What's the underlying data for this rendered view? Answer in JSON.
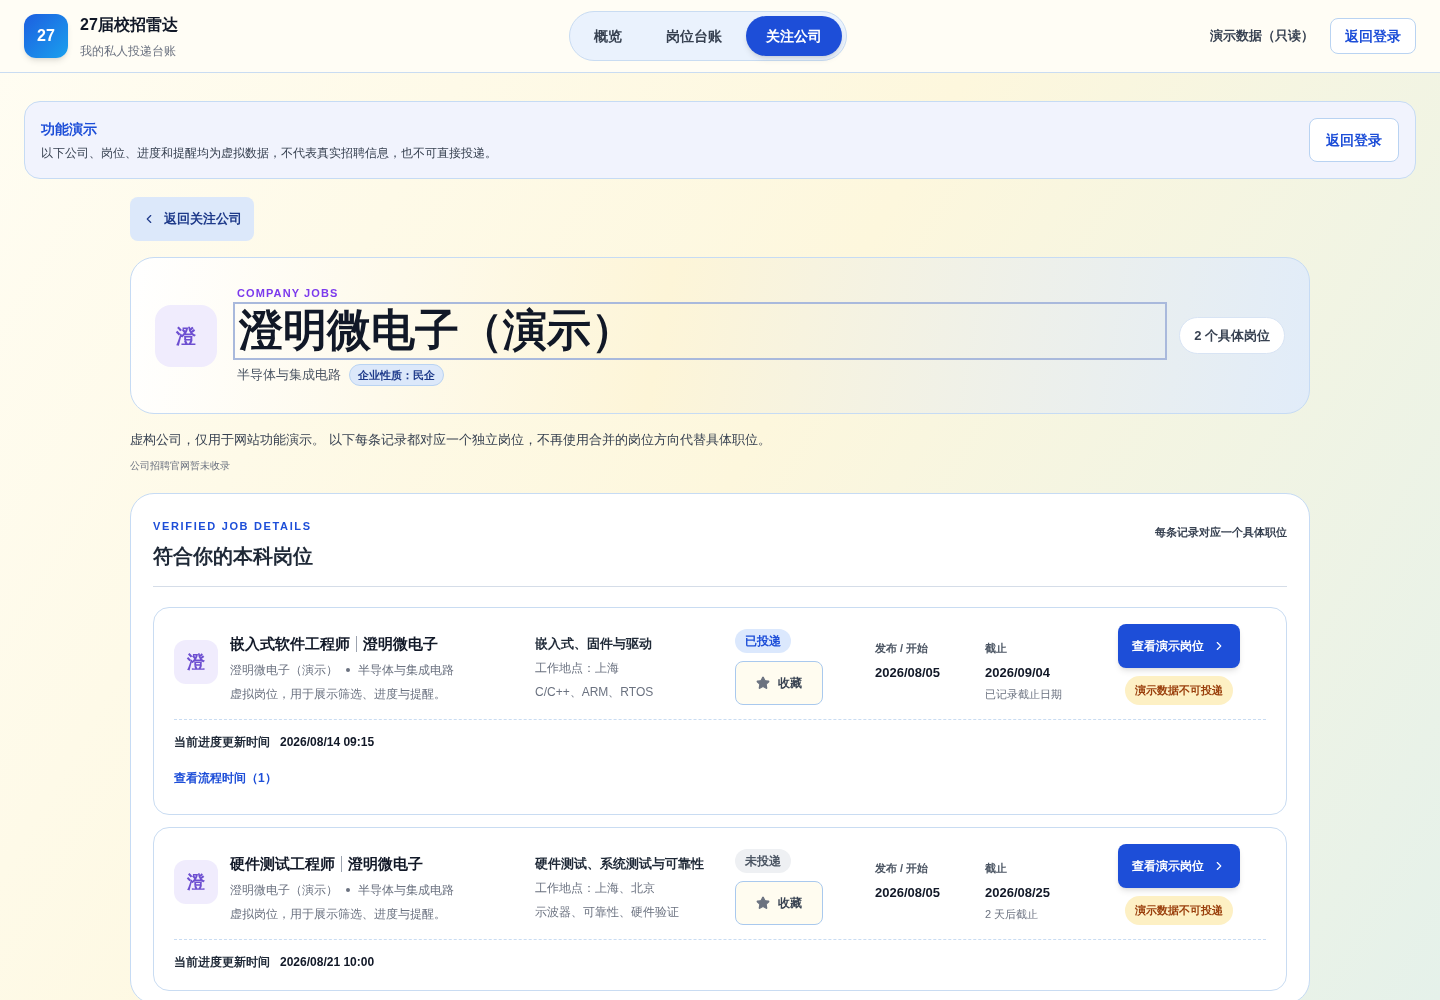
{
  "app": {
    "logo": "27",
    "title": "27届校招雷达",
    "subtitle": "我的私人投递台账"
  },
  "tabs": [
    {
      "label": "概览",
      "selected": false
    },
    {
      "label": "岗位台账",
      "selected": false
    },
    {
      "label": "关注公司",
      "selected": true
    }
  ],
  "header_right": {
    "mode": "演示数据（只读）",
    "login": "返回登录"
  },
  "notice": {
    "title": "功能演示",
    "text": "以下公司、岗位、进度和提醒均为虚拟数据，不代表真实招聘信息，也不可直接投递。",
    "button": "返回登录"
  },
  "back_button": "返回关注公司",
  "company": {
    "avatar": "澄",
    "eyebrow": "COMPANY JOBS",
    "name": "澄明微电子（演示）",
    "name_focused": true,
    "industry": "半导体与集成电路",
    "tag": "企业性质：民企",
    "count": "2 个具体岗位"
  },
  "description": "虚构公司，仅用于网站功能演示。 以下每条记录都对应一个独立岗位，不再使用合并的岗位方向代替具体职位。",
  "site_note": "公司招聘官网暂未收录",
  "jobs_section": {
    "eyebrow": "VERIFIED JOB DETAILS",
    "title": "符合你的本科岗位",
    "note": "每条记录对应一个具体职位"
  },
  "jobs": [
    {
      "avatar": "澄",
      "title": "嵌入式软件工程师",
      "company": "澄明微电子",
      "company_full": "澄明微电子（演示）",
      "industry": "半导体与集成电路",
      "desc": "虚拟岗位，用于展示筛选、进度与提醒。",
      "direction": "嵌入式、固件与驱动",
      "location": "工作地点：上海",
      "skills": "C/C++、ARM、RTOS",
      "status": "已投递",
      "applied": true,
      "favorite": "收藏",
      "start_label": "发布 / 开始",
      "start": "2026/08/05",
      "deadline_label": "截止",
      "deadline": "2026/09/04",
      "deadline_note": "已记录截止日期",
      "view": "查看演示岗位",
      "warn": "演示数据不可投递",
      "progress_label": "当前进度更新时间",
      "progress_time": "2026/08/14 09:15",
      "timeline_link": "查看流程时间（1）"
    },
    {
      "avatar": "澄",
      "title": "硬件测试工程师",
      "company": "澄明微电子",
      "company_full": "澄明微电子（演示）",
      "industry": "半导体与集成电路",
      "desc": "虚拟岗位，用于展示筛选、进度与提醒。",
      "direction": "硬件测试、系统测试与可靠性",
      "location": "工作地点：上海、北京",
      "skills": "示波器、可靠性、硬件验证",
      "status": "未投递",
      "applied": false,
      "favorite": "收藏",
      "start_label": "发布 / 开始",
      "start": "2026/08/05",
      "deadline_label": "截止",
      "deadline": "2026/08/25",
      "deadline_note": "2 天后截止",
      "view": "查看演示岗位",
      "warn": "演示数据不可投递",
      "progress_label": "当前进度更新时间",
      "progress_time": "2026/08/21 10:00"
    }
  ]
}
